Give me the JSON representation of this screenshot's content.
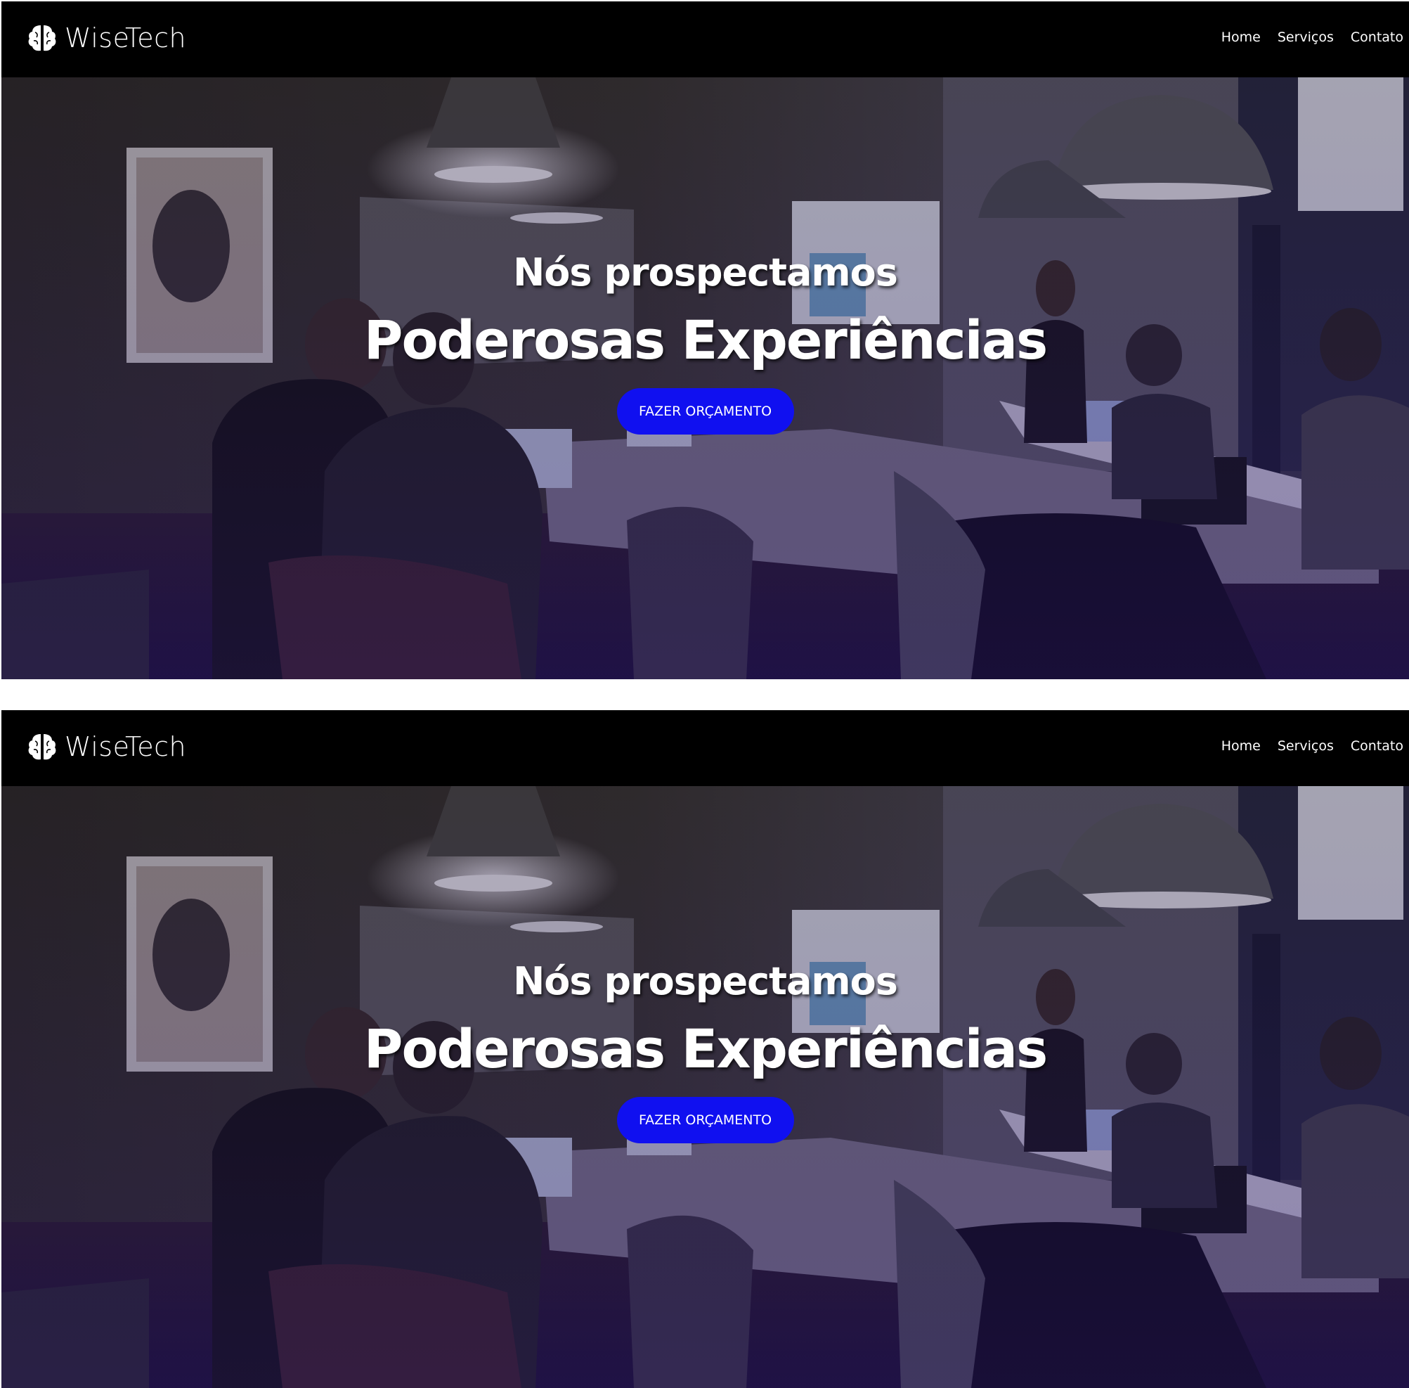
{
  "brand": {
    "name": "WiseTech",
    "logo_icon": "brain-icon"
  },
  "nav": {
    "items": [
      "Home",
      "Serviços",
      "Contato"
    ]
  },
  "hero": {
    "kicker": "Nós prospectamos",
    "title": "Poderosas Experiências",
    "cta_label": "FAZER ORÇAMENTO",
    "background_scene": "meeting-room-photo"
  },
  "colors": {
    "navbar": "#000000",
    "cta": "#1010f0",
    "text": "#ffffff"
  }
}
